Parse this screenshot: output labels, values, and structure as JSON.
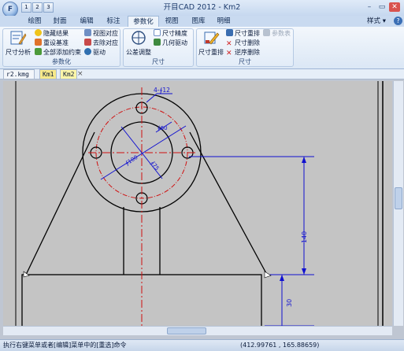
{
  "window": {
    "title": "开目CAD 2012 - Km2",
    "logo_letter": "F",
    "quick_access": [
      "1",
      "2",
      "3"
    ],
    "controls": {
      "minimize": "–",
      "restore": "▭",
      "close": "✕"
    },
    "help_icon": "?",
    "style_menu": "样式 ▾"
  },
  "ribbon_tabs": [
    "绘图",
    "封面",
    "编辑",
    "标注",
    "参数化",
    "视图",
    "图库",
    "明细"
  ],
  "active_tab": "参数化",
  "groups": {
    "param": {
      "label": "参数化",
      "big": "尺寸分析",
      "col1": [
        "隐藏结果",
        "重设基准",
        "全部添加约束"
      ],
      "col2": [
        "视图对应",
        "去除对应",
        "驱动"
      ]
    },
    "dimension": {
      "label": "尺寸",
      "big": "公差调整",
      "col1": [
        "尺寸精度",
        "几何驱动"
      ]
    },
    "arrange": {
      "label": "尺寸",
      "big": "尺寸重排",
      "col1": [
        "尺寸重排",
        "尺寸删除",
        "逆序删除"
      ],
      "col2": [
        "参数表"
      ]
    }
  },
  "doc_tabs": [
    "r2.kmg",
    "Km1",
    "Km2"
  ],
  "active_doc": "Km2",
  "doc_close": "×",
  "drawing": {
    "hole_label": "4-∮12",
    "pcd_label": "∮60",
    "inner_label": "∮100",
    "bore_label": "∮75",
    "height_label": "140",
    "base_label": "30",
    "bg_color": "#c4c4c4",
    "dim_color": "#1010d0",
    "center_color": "#d01010"
  },
  "status": {
    "message": "执行右键菜单或者[编辑]菜单中的[重选]命令",
    "coords": "(412.99761 , 165.88659)"
  }
}
